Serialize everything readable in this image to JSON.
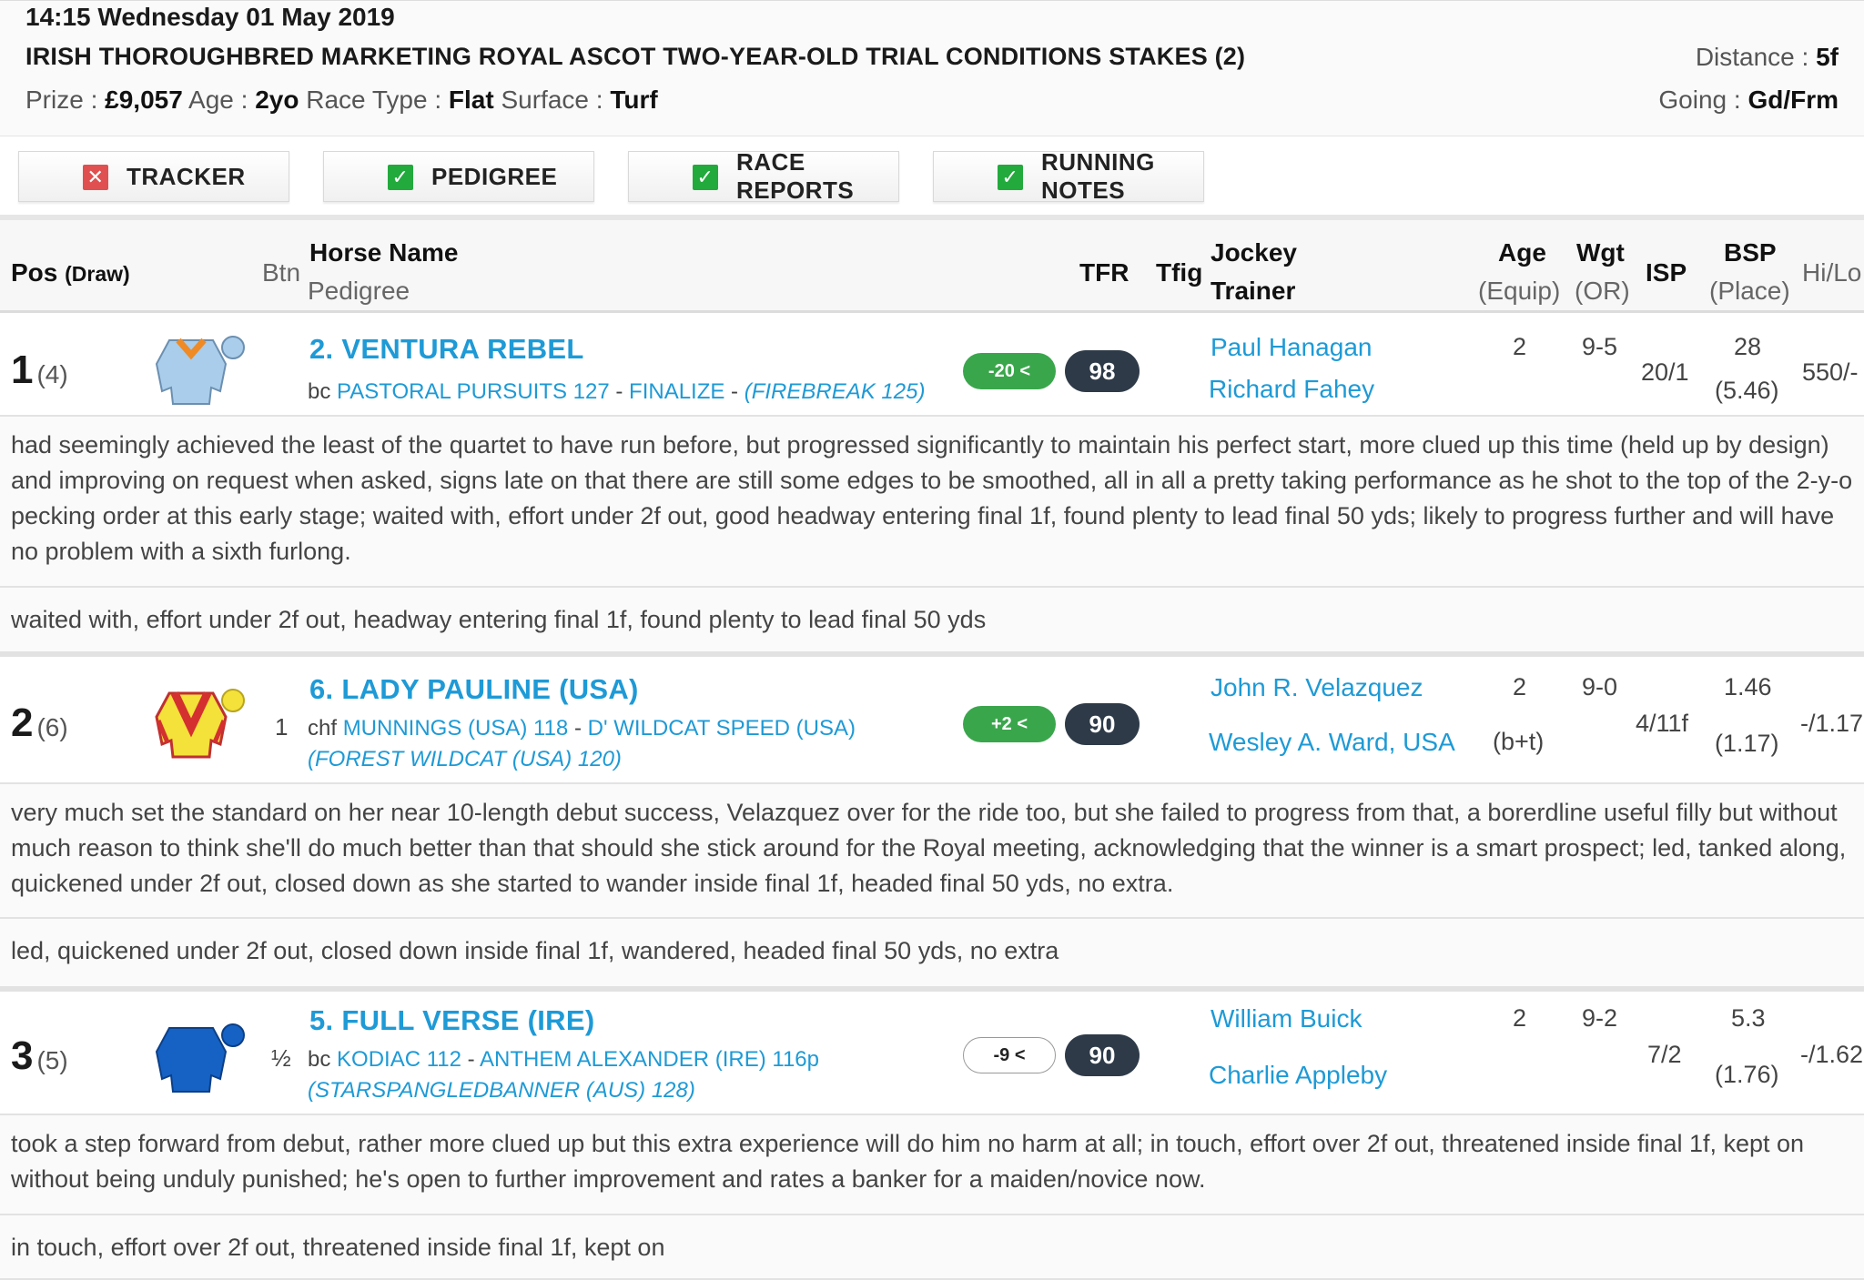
{
  "race": {
    "datetime": "14:15 Wednesday 01 May 2019",
    "title": "IRISH THOROUGHBRED MARKETING ROYAL ASCOT TWO-YEAR-OLD TRIAL CONDITIONS STAKES (2)",
    "prize_label": "Prize : ",
    "prize": "£9,057",
    "age_label": " Age : ",
    "age": "2yo",
    "type_label": " Race Type : ",
    "type": "Flat",
    "surface_label": " Surface : ",
    "surface": "Turf",
    "distance_label": "Distance : ",
    "distance": "5f",
    "going_label": "Going : ",
    "going": "Gd/Frm"
  },
  "toolbar": {
    "tracker": "TRACKER",
    "pedigree": "PEDIGREE",
    "race_reports": "RACE REPORTS",
    "running_notes": "RUNNING NOTES"
  },
  "columns": {
    "pos": "Pos",
    "draw": "(Draw)",
    "btn": "Btn",
    "horse": "Horse Name",
    "pedigree": "Pedigree",
    "tfr": "TFR",
    "tfig": "Tfig",
    "jockey": "Jockey",
    "trainer": "Trainer",
    "age": "Age",
    "equip": "(Equip)",
    "wgt": "Wgt",
    "or": "(OR)",
    "isp": "ISP",
    "bsp": "BSP",
    "place": "(Place)",
    "hilo": "Hi/Lo"
  },
  "colors": {
    "link": "#1e9ad6",
    "green": "#3aa64c",
    "dark_badge": "#2e3a48",
    "cross_red": "#e05050",
    "check_green": "#22aa3c"
  },
  "runners": [
    {
      "pos": "1",
      "draw": "(4)",
      "btn": "",
      "name": "2. VENTURA REBEL",
      "sex": "bc",
      "sire": "PASTORAL PURSUITS 127",
      "sep1": " - ",
      "dam": "FINALIZE",
      "sep2": " - ",
      "damsire": "(FIREBREAK 125)",
      "tfig": "-20 <",
      "tfr": "98",
      "jockey": "Paul Hanagan",
      "trainer": "Richard Fahey",
      "age": "2",
      "equip": "",
      "wgt": "9-5",
      "isp": "20/1",
      "bsp": "28",
      "place": "(5.46)",
      "hilo": "550/-",
      "silk_icon": "silk-light-blue-orange",
      "comment": "had seemingly achieved the least of the quartet to have run before, but progressed significantly to maintain his perfect start, more clued up this time (held up by design) and improving on request when asked, signs late on that there are still some edges to be smoothed, all in all a pretty taking performance as he shot to the top of the 2-y-o pecking order at this early stage; waited with, effort under 2f out, good headway entering final 1f, found plenty to lead final 50 yds; likely to progress further and will have no problem with a sixth furlong.",
      "note": "waited with, effort under 2f out, headway entering final 1f, found plenty to lead final 50 yds"
    },
    {
      "pos": "2",
      "draw": "(6)",
      "btn": "1",
      "name": "6. LADY PAULINE (USA)",
      "sex": "chf",
      "sire": "MUNNINGS (USA) 118",
      "sep1": " - ",
      "dam": "D' WILDCAT SPEED (USA)",
      "sep2": " ",
      "damsire": "(FOREST WILDCAT (USA) 120)",
      "tfig": "+2 <",
      "tfr": "90",
      "jockey": "John R. Velazquez",
      "trainer": "Wesley A. Ward, USA",
      "age": "2",
      "equip": "(b+t)",
      "wgt": "9-0",
      "isp": "4/11f",
      "bsp": "1.46",
      "place": "(1.17)",
      "hilo": "-/1.17",
      "silk_icon": "silk-yellow-red-chevron",
      "comment": "very much set the standard on her near 10-length debut success, Velazquez over for the ride too, but she failed to progress from that, a borerdline useful filly but without much reason to think she'll do much better than that should she stick around for the Royal meeting, acknowledging that the winner is a smart prospect; led, tanked along, quickened under 2f out, closed down as she started to wander inside final 1f, headed final 50 yds, no extra.",
      "note": "led, quickened under 2f out, closed down inside final 1f, wandered, headed final 50 yds, no extra"
    },
    {
      "pos": "3",
      "draw": "(5)",
      "btn": "½",
      "name": "5. FULL VERSE (IRE)",
      "sex": "bc",
      "sire": "KODIAC 112",
      "sep1": " - ",
      "dam": "ANTHEM ALEXANDER (IRE) 116p",
      "sep2": " ",
      "damsire": "(STARSPANGLEDBANNER (AUS) 128)",
      "tfig": "-9 <",
      "tfr": "90",
      "jockey": "William Buick",
      "trainer": "Charlie Appleby",
      "age": "2",
      "equip": "",
      "wgt": "9-2",
      "isp": "7/2",
      "bsp": "5.3",
      "place": "(1.76)",
      "hilo": "-/1.62",
      "silk_icon": "silk-royal-blue",
      "comment": "took a step forward from debut, rather more clued up but this extra experience will do him no harm at all; in touch, effort over 2f out, threatened inside final 1f, kept on without being unduly punished; he's open to further improvement and rates a banker for a maiden/novice now.",
      "note": "in touch, effort over 2f out, threatened inside final 1f, kept on"
    }
  ]
}
